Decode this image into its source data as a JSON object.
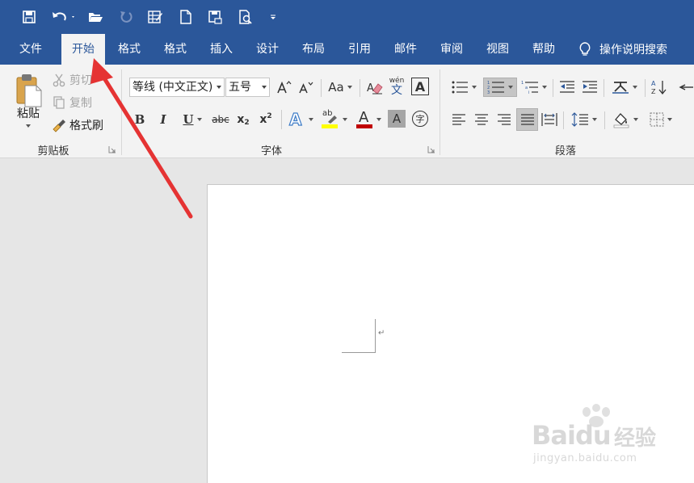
{
  "tabs": [
    {
      "label": "文件"
    },
    {
      "label": "开始"
    },
    {
      "label": "格式"
    },
    {
      "label": "格式"
    },
    {
      "label": "插入"
    },
    {
      "label": "设计"
    },
    {
      "label": "布局"
    },
    {
      "label": "引用"
    },
    {
      "label": "邮件"
    },
    {
      "label": "审阅"
    },
    {
      "label": "视图"
    },
    {
      "label": "帮助"
    }
  ],
  "active_tab": "开始",
  "help_search": "操作说明搜索",
  "clipboard": {
    "paste": "粘贴",
    "cut": "剪切",
    "copy": "复制",
    "format_painter": "格式刷",
    "group_label": "剪贴板"
  },
  "font": {
    "name": "等线 (中文正文)",
    "size": "五号",
    "phonetic_top": "wén",
    "phonetic_bottom": "文",
    "change_case": "Aa",
    "bold": "B",
    "italic": "I",
    "underline": "U",
    "strike": "abc",
    "subscript_base": "x",
    "subscript_mark": "2",
    "superscript_base": "x",
    "superscript_mark": "2",
    "highlight_letters": "ab",
    "font_color_letter": "A",
    "shading_letter": "A",
    "enclose_char": "字",
    "group_label": "字体",
    "highlight_color": "#ffff00",
    "font_color": "#c00000"
  },
  "paragraph": {
    "group_label": "段落"
  },
  "document": {
    "return_mark": "↵"
  },
  "colors": {
    "ribbon_blue": "#2b579a",
    "arrow_red": "#e53333"
  },
  "watermark": {
    "brand": "Baidu",
    "brand_cn": "经验",
    "url": "jingyan.baidu.com"
  }
}
